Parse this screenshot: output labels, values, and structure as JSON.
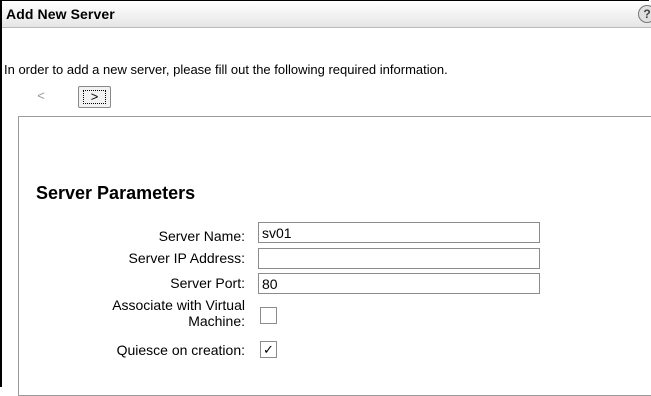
{
  "dialog": {
    "title": "Add New Server",
    "help_icon": "help-icon",
    "help_glyph": "?",
    "instructions": "In order to add a new server, please fill out the following required information.",
    "prev_label": "<",
    "next_label": ">"
  },
  "form": {
    "section_title": "Server Parameters",
    "server_name": {
      "label": "Server Name:",
      "value": "sv01"
    },
    "server_ip": {
      "label": "Server IP Address:",
      "value": ""
    },
    "server_port": {
      "label": "Server Port:",
      "value": "80"
    },
    "associate_vm": {
      "label_line1": "Associate with Virtual",
      "label_line2": "Machine:",
      "checked": false
    },
    "quiesce": {
      "label": "Quiesce on creation:",
      "checked": true,
      "check_glyph": "✓"
    }
  }
}
